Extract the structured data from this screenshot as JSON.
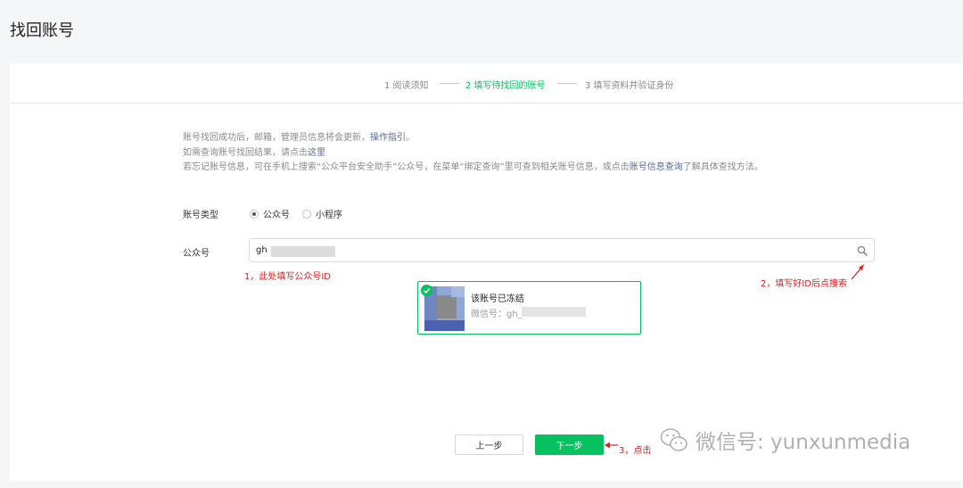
{
  "page": {
    "title": "找回账号"
  },
  "steps": [
    {
      "label": "1 阅读须知"
    },
    {
      "label": "2 填写待找回的账号"
    },
    {
      "label": "3 填写资料并验证身份"
    }
  ],
  "notes": {
    "line1_prefix": "账号找回成功后，邮箱，管理员信息将会更新，",
    "line1_link": "操作指引",
    "line1_suffix": "。",
    "line2_prefix": "如需查询账号找回结果，请点击",
    "line2_link": "这里",
    "line3_prefix": "若忘记账号信息，可在手机上搜索“公众平台安全助手”公众号，在菜单“绑定查询”里可查到相关账号信息，或点击",
    "line3_link": "账号信息查询",
    "line3_suffix": "了解具体查找方法。"
  },
  "form": {
    "type_label": "账号类型",
    "type_options": [
      {
        "label": "公众号",
        "checked": true
      },
      {
        "label": "小程序",
        "checked": false
      }
    ],
    "account_label": "公众号",
    "search_value": "gh"
  },
  "annotations": {
    "hint1": "1，此处填写公众号ID",
    "hint2": "2，填写好ID后点搜索",
    "hint3": "3，点击"
  },
  "result": {
    "name": "该账号已冻结",
    "id_prefix": "微信号：gh_"
  },
  "buttons": {
    "prev": "上一步",
    "next": "下一步"
  },
  "watermark": {
    "text": "微信号: yunxunmedia"
  },
  "colors": {
    "accent": "#07c160",
    "link": "#576b95",
    "annotation": "#e02020"
  }
}
